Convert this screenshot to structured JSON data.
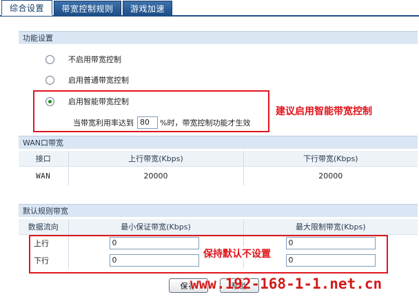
{
  "tabs": [
    {
      "label": "综合设置",
      "active": true
    },
    {
      "label": "带宽控制规则",
      "active": false
    },
    {
      "label": "游戏加速",
      "active": false
    }
  ],
  "function_settings": {
    "title": "功能设置",
    "options": [
      {
        "label": "不启用带宽控制",
        "checked": false
      },
      {
        "label": "启用普通带宽控制",
        "checked": false
      },
      {
        "label": "启用智能带宽控制",
        "checked": true
      }
    ],
    "threshold": {
      "prefix": "当带宽利用率达到",
      "value": "80",
      "suffix": "%时，带宽控制功能才生效"
    },
    "annotation": "建议启用智能带宽控制"
  },
  "wan_bandwidth": {
    "title": "WAN口带宽",
    "columns": [
      "接口",
      "上行带宽(Kbps)",
      "下行带宽(Kbps)"
    ],
    "rows": [
      {
        "iface": "WAN",
        "up": "20000",
        "down": "20000"
      }
    ]
  },
  "default_rules": {
    "title": "默认规则带宽",
    "columns": [
      "数据流向",
      "最小保证带宽(Kbps)",
      "最大限制带宽(Kbps)"
    ],
    "rows": [
      {
        "direction": "上行",
        "min": "0",
        "max": "0"
      },
      {
        "direction": "下行",
        "min": "0",
        "max": "0"
      }
    ],
    "annotation": "保持默认不设置"
  },
  "buttons": {
    "save": "保存",
    "help": "帮助"
  },
  "watermark": "www.192-168-1-1.net.cn",
  "colors": {
    "tab_blue": "#1d4f86",
    "section_bg": "#dae6f3",
    "annotation_red": "#e0141c"
  }
}
